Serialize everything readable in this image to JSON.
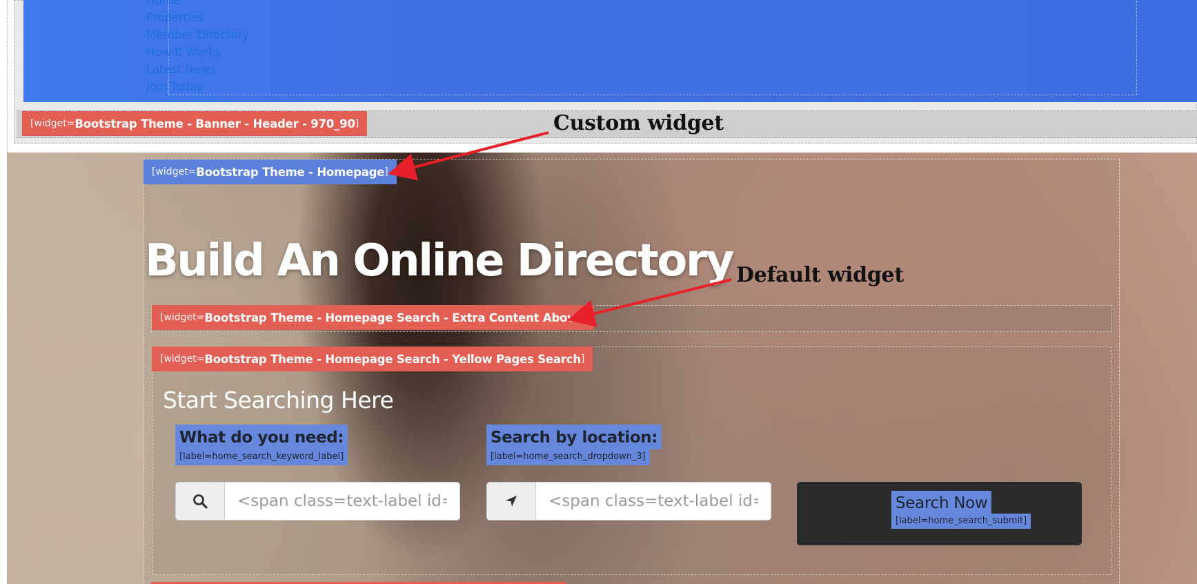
{
  "nav": {
    "items": [
      {
        "label": "Home"
      },
      {
        "label": "Properties"
      },
      {
        "label": "Member Directory"
      },
      {
        "label": "How It Works"
      },
      {
        "label": "Latest News"
      },
      {
        "label": "Join Today"
      }
    ]
  },
  "widgets": {
    "prefix": "[widget=",
    "suffix": "]",
    "banner_header": "Bootstrap Theme - Banner - Header - 970_90",
    "homepage": "Bootstrap Theme - Homepage",
    "extra_content_above": "Bootstrap Theme - Homepage Search - Extra Content Above",
    "yellow_pages_search": "Bootstrap Theme - Homepage Search - Yellow Pages Search"
  },
  "hero": {
    "title": "Build An Online Directory"
  },
  "search": {
    "heading": "Start Searching Here",
    "keyword": {
      "label": "What do you need:",
      "label_key": "[label=home_search_keyword_label]",
      "placeholder": "<span class=text-label id=cus"
    },
    "location": {
      "label": "Search by location:",
      "label_key": "[label=home_search_dropdown_3]",
      "placeholder": "<span class=text-label id=cus"
    },
    "submit": {
      "label": "Search Now",
      "label_key": "[label=home_search_submit]"
    }
  },
  "annotations": {
    "custom": "Custom widget",
    "default": "Default widget"
  },
  "colors": {
    "nav_blue": "#3f6fe0",
    "widget_red": "#e35f54",
    "widget_blue": "#5b81dd",
    "label_blue": "#6587dc",
    "button_dark": "#2b2b2b",
    "arrow_red": "#e8202a"
  },
  "icons": {
    "keyword": "search-icon",
    "location": "location-arrow-icon"
  }
}
